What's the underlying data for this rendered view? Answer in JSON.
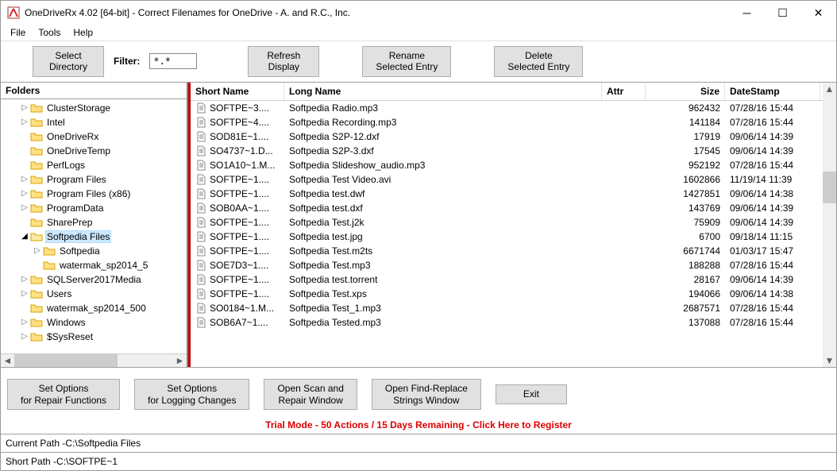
{
  "window": {
    "title": "OneDriveRx 4.02 [64-bit] - Correct Filenames for OneDrive - A. and R.C., Inc."
  },
  "menu": {
    "file": "File",
    "tools": "Tools",
    "help": "Help"
  },
  "toolbar": {
    "select_directory": "Select\nDirectory",
    "filter_label": "Filter:",
    "filter_value": "*.*",
    "refresh": "Refresh\nDisplay",
    "rename": "Rename\nSelected Entry",
    "delete": "Delete\nSelected Entry"
  },
  "folders": {
    "header": "Folders",
    "items": [
      {
        "d": 1,
        "exp": ">",
        "open": false,
        "label": "ClusterStorage",
        "sel": false
      },
      {
        "d": 1,
        "exp": ">",
        "open": false,
        "label": "Intel",
        "sel": false
      },
      {
        "d": 1,
        "exp": "",
        "open": false,
        "label": "OneDriveRx",
        "sel": false
      },
      {
        "d": 1,
        "exp": "",
        "open": false,
        "label": "OneDriveTemp",
        "sel": false
      },
      {
        "d": 1,
        "exp": "",
        "open": false,
        "label": "PerfLogs",
        "sel": false
      },
      {
        "d": 1,
        "exp": ">",
        "open": false,
        "label": "Program Files",
        "sel": false
      },
      {
        "d": 1,
        "exp": ">",
        "open": false,
        "label": "Program Files (x86)",
        "sel": false
      },
      {
        "d": 1,
        "exp": ">",
        "open": false,
        "label": "ProgramData",
        "sel": false
      },
      {
        "d": 1,
        "exp": "",
        "open": false,
        "label": "SharePrep",
        "sel": false
      },
      {
        "d": 1,
        "exp": "v",
        "open": true,
        "label": "Softpedia Files",
        "sel": true
      },
      {
        "d": 2,
        "exp": ">",
        "open": false,
        "label": "Softpedia",
        "sel": false
      },
      {
        "d": 2,
        "exp": "",
        "open": false,
        "label": "watermak_sp2014_5",
        "sel": false
      },
      {
        "d": 1,
        "exp": ">",
        "open": false,
        "label": "SQLServer2017Media",
        "sel": false
      },
      {
        "d": 1,
        "exp": ">",
        "open": false,
        "label": "Users",
        "sel": false
      },
      {
        "d": 1,
        "exp": "",
        "open": false,
        "label": "watermak_sp2014_500",
        "sel": false
      },
      {
        "d": 1,
        "exp": ">",
        "open": false,
        "label": "Windows",
        "sel": false
      },
      {
        "d": 1,
        "exp": ">",
        "open": false,
        "label": "$SysReset",
        "sel": false
      }
    ]
  },
  "columns": {
    "short": "Short Name",
    "long": "Long Name",
    "attr": "Attr",
    "size": "Size",
    "date": "DateStamp"
  },
  "files": [
    {
      "short": "SOFTPE~3....",
      "long": "Softpedia Radio.mp3",
      "attr": "",
      "size": "962432",
      "date": "07/28/16 15:44"
    },
    {
      "short": "SOFTPE~4....",
      "long": "Softpedia Recording.mp3",
      "attr": "",
      "size": "141184",
      "date": "07/28/16 15:44"
    },
    {
      "short": "SOD81E~1....",
      "long": "Softpedia S2P-12.dxf",
      "attr": "",
      "size": "17919",
      "date": "09/06/14 14:39"
    },
    {
      "short": "SO4737~1.D...",
      "long": "Softpedia S2P-3.dxf",
      "attr": "",
      "size": "17545",
      "date": "09/06/14 14:39"
    },
    {
      "short": "SO1A10~1.M...",
      "long": "Softpedia Slideshow_audio.mp3",
      "attr": "",
      "size": "952192",
      "date": "07/28/16 15:44"
    },
    {
      "short": "SOFTPE~1....",
      "long": "Softpedia Test Video.avi",
      "attr": "",
      "size": "1602866",
      "date": "11/19/14 11:39"
    },
    {
      "short": "SOFTPE~1....",
      "long": "Softpedia test.dwf",
      "attr": "",
      "size": "1427851",
      "date": "09/06/14 14:38"
    },
    {
      "short": "SOB0AA~1....",
      "long": "Softpedia test.dxf",
      "attr": "",
      "size": "143769",
      "date": "09/06/14 14:39"
    },
    {
      "short": "SOFTPE~1....",
      "long": "Softpedia Test.j2k",
      "attr": "",
      "size": "75909",
      "date": "09/06/14 14:39"
    },
    {
      "short": "SOFTPE~1....",
      "long": "Softpedia test.jpg",
      "attr": "",
      "size": "6700",
      "date": "09/18/14 11:15"
    },
    {
      "short": "SOFTPE~1....",
      "long": "Softpedia Test.m2ts",
      "attr": "",
      "size": "6671744",
      "date": "01/03/17 15:47"
    },
    {
      "short": "SOE7D3~1....",
      "long": "Softpedia Test.mp3",
      "attr": "",
      "size": "188288",
      "date": "07/28/16 15:44"
    },
    {
      "short": "SOFTPE~1....",
      "long": "Softpedia test.torrent",
      "attr": "",
      "size": "28167",
      "date": "09/06/14 14:39"
    },
    {
      "short": "SOFTPE~1....",
      "long": "Softpedia Test.xps",
      "attr": "",
      "size": "194066",
      "date": "09/06/14 14:38"
    },
    {
      "short": "SO0184~1.M...",
      "long": "Softpedia Test_1.mp3",
      "attr": "",
      "size": "2687571",
      "date": "07/28/16 15:44"
    },
    {
      "short": "SOB6A7~1....",
      "long": "Softpedia Tested.mp3",
      "attr": "",
      "size": "137088",
      "date": "07/28/16 15:44"
    }
  ],
  "bottom": {
    "set_repair": "Set Options\nfor Repair Functions",
    "set_logging": "Set Options\nfor Logging Changes",
    "open_scan": "Open Scan and\nRepair Window",
    "open_find": "Open Find-Replace\nStrings Window",
    "exit": "Exit"
  },
  "trial": "Trial Mode - 50 Actions / 15 Days Remaining  -  Click Here to Register",
  "status": {
    "current_path_label": "Current Path - ",
    "current_path_value": "C:\\Softpedia Files",
    "short_path_label": "Short Path - ",
    "short_path_value": "C:\\SOFTPE~1"
  }
}
